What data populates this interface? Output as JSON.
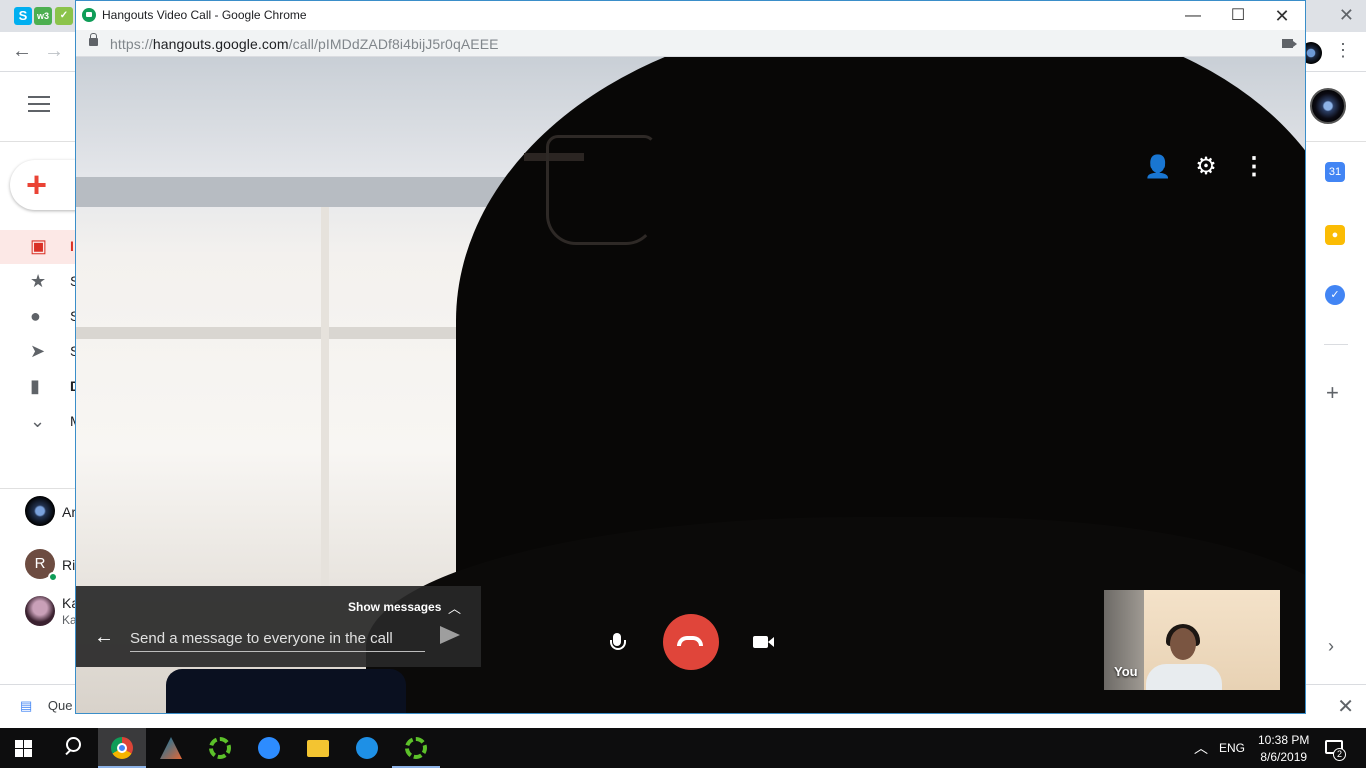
{
  "popup_window": {
    "title": "Hangouts Video Call - Google Chrome",
    "url_prefix": "https://",
    "url_domain": "hangouts.google.com",
    "url_path": "/call/pIMDdZADf8i4bijJ5r0qAEEE",
    "controls": {
      "close": "✕",
      "minimize": "—",
      "maximize": "☐"
    }
  },
  "call": {
    "show_messages_label": "Show messages",
    "message_placeholder": "Send a message to everyone in the call",
    "self_view_label": "You",
    "hangup_color": "#e0453a"
  },
  "background_browser": {
    "nav_back": "←",
    "nav_forward": "→",
    "download_item": "Que",
    "download_close": "✕",
    "gmail_nav_labels": [
      "I",
      "S",
      "S",
      "S",
      "D",
      "M"
    ],
    "chat_contacts": [
      {
        "initial": "",
        "name_fragment": "Ar"
      },
      {
        "initial": "R",
        "name_fragment": "Ri"
      },
      {
        "initial": "",
        "name_fragment": "Ka"
      }
    ],
    "chat_contact_subtext": "Ka",
    "calendar_badge": "31"
  },
  "taskbar": {
    "language": "ENG",
    "time": "10:38 PM",
    "date": "8/6/2019",
    "notification_count": "2"
  }
}
